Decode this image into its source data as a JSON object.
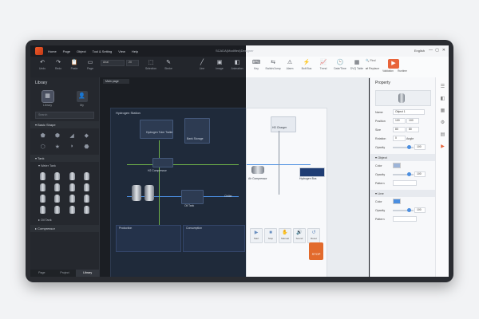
{
  "menu": {
    "items": [
      "Home",
      "Page",
      "Object",
      "Tool & Setting",
      "View",
      "Help"
    ],
    "doc_title": "SCADA(Modified)Designer",
    "language": "English",
    "window_controls": [
      "—",
      "▢",
      "✕"
    ]
  },
  "toolbar": {
    "left_buttons": [
      {
        "label": "Undo",
        "icon": "↶"
      },
      {
        "label": "Redo",
        "icon": "↷"
      },
      {
        "label": "Paste",
        "icon": "📋"
      },
      {
        "label": "Page",
        "icon": "▭"
      }
    ],
    "font_name": "Arial",
    "font_size": "20",
    "mid_buttons": [
      {
        "label": "Selection",
        "icon": "⬚"
      },
      {
        "label": "Stroke",
        "icon": "✎"
      },
      {
        "label": "Line",
        "icon": "╱"
      },
      {
        "label": "Image",
        "icon": "▣"
      },
      {
        "label": "Animation",
        "icon": "◧"
      }
    ],
    "right_buttons": [
      {
        "label": "Key",
        "icon": "⌨"
      },
      {
        "label": "Switch/Jump",
        "icon": "⇆"
      },
      {
        "label": "Alarm",
        "icon": "⚠"
      },
      {
        "label": "Bolt Bus",
        "icon": "⚡"
      },
      {
        "label": "Trend",
        "icon": "📈"
      },
      {
        "label": "Date/Time",
        "icon": "🕒"
      },
      {
        "label": "DVQ Table",
        "icon": "▦"
      }
    ],
    "find_label": "Find",
    "replace_label": "Replace",
    "validation_label": "Validation",
    "run_label": "Runtime",
    "run_icon": "▶"
  },
  "left_panel": {
    "title": "Library",
    "tabs": [
      {
        "label": "Library",
        "icon": "▦"
      },
      {
        "label": "My",
        "icon": "👤"
      }
    ],
    "search_placeholder": "Search",
    "section_basic": "Basic Shape",
    "basic_icons": [
      "⬟",
      "⬢",
      "◢",
      "◆",
      "⬡",
      "★",
      "◗",
      "⬣"
    ],
    "section_tank": "Tank",
    "subsection_water": "Water Tank",
    "subsection_oil": "Oil Tank",
    "section_compressor": "Compressor",
    "footer_tabs": [
      "Page",
      "Project",
      "Library"
    ]
  },
  "canvas": {
    "page_tab": "Main page",
    "scada_title": "Hydrogen Station",
    "labels": {
      "tube_trailer": "Hydrogen Tube Trailer",
      "bank_storage": "Bank Storage",
      "chiller": "Chiller",
      "oil_tank": "Oil Tank",
      "h2_compressor": "H2 Compressor",
      "air_compressor": "Air Compressor",
      "charger": "HD Charger",
      "hydrogen_bus": "Hydrogen Bus",
      "production": "Production",
      "consumption": "Consumption",
      "stop": "STOP"
    },
    "controls": [
      {
        "label": "Start",
        "icon": "▶"
      },
      {
        "label": "Stop",
        "icon": "■"
      },
      {
        "label": "Manual",
        "icon": "✋"
      },
      {
        "label": "Sound",
        "icon": "🔊"
      },
      {
        "label": "Reset",
        "icon": "↺"
      }
    ]
  },
  "right_panel": {
    "title": "Property",
    "name_label": "Name",
    "name_value": "Object 1",
    "position_label": "Position",
    "pos_x": "100",
    "pos_y": "100",
    "size_label": "Size",
    "size_w": "80",
    "size_h": "80",
    "rotation_label": "Rotation",
    "rotation_value": "0",
    "angle_label": "Angle",
    "opacity_label": "Opacity",
    "opacity_value": "100",
    "object_section": "Object",
    "color_label": "Color",
    "pattern_label": "Pattern",
    "line_section": "Line",
    "accent_color": "#e8643a"
  }
}
